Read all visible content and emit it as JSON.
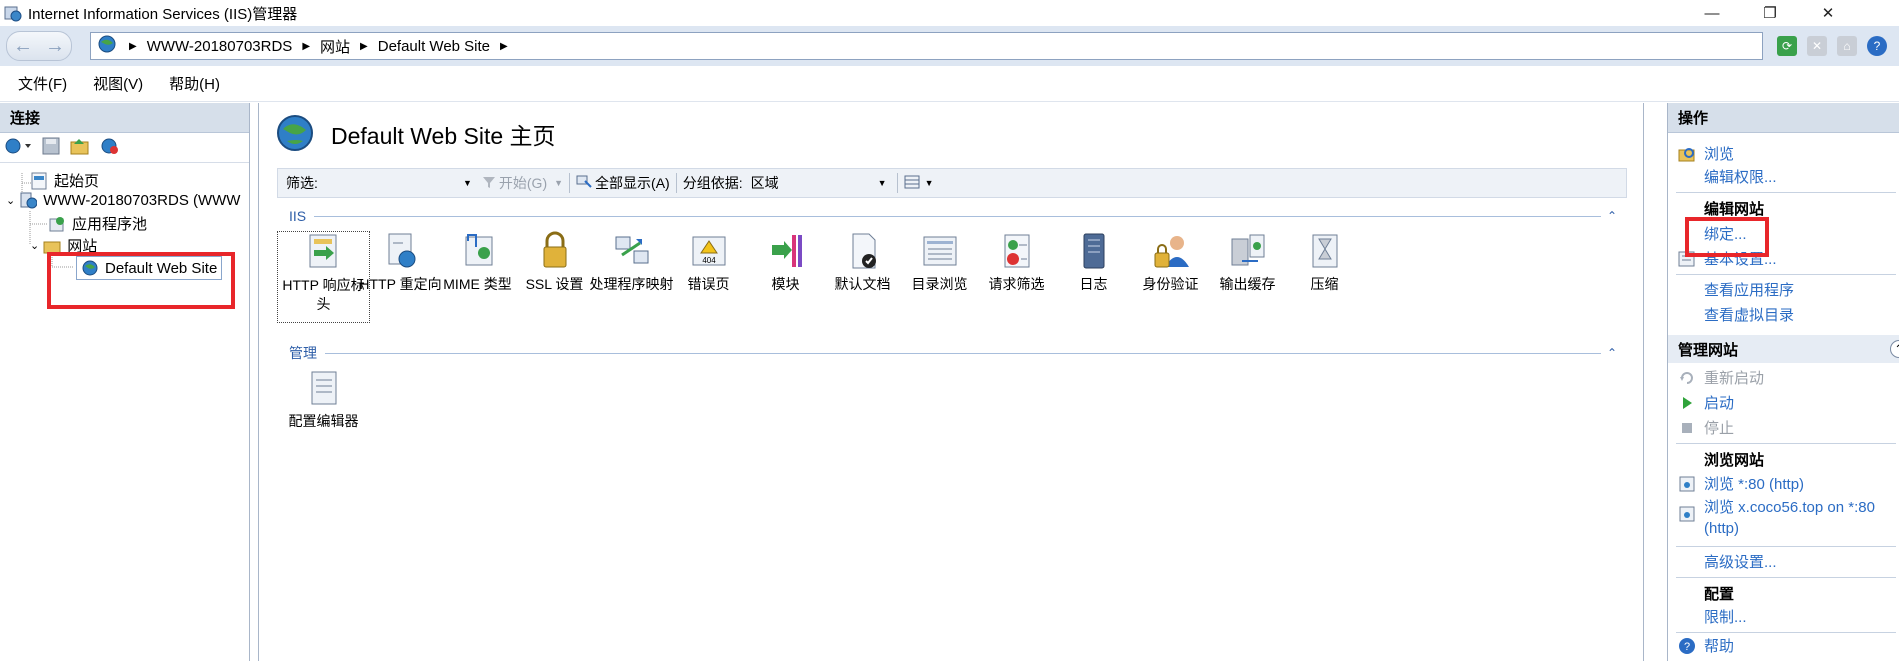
{
  "window": {
    "title": "Internet Information Services (IIS)管理器",
    "minimize": "—",
    "restore": "❐",
    "close": "✕"
  },
  "address": {
    "crumbs": [
      "WWW-20180703RDS",
      "网站",
      "Default Web Site"
    ]
  },
  "menu": [
    "文件(F)",
    "视图(V)",
    "帮助(H)"
  ],
  "left": {
    "header": "连接",
    "tree": {
      "start_page": "起始页",
      "server": "WWW-20180703RDS (WWW",
      "app_pools": "应用程序池",
      "sites": "网站",
      "default_site": "Default Web Site"
    }
  },
  "center": {
    "title": "Default Web Site 主页",
    "filter": {
      "label": "筛选:",
      "start": "开始(G)",
      "show_all": "全部显示(A)",
      "group_by_label": "分组依据:",
      "group_by_value": "区域"
    },
    "groups": {
      "iis": "IIS",
      "manage": "管理"
    },
    "iis_features": [
      "HTTP 响应标头",
      "HTTP 重定向",
      "MIME 类型",
      "SSL 设置",
      "处理程序映射",
      "错误页",
      "模块",
      "默认文档",
      "目录浏览",
      "请求筛选",
      "日志",
      "身份验证",
      "输出缓存",
      "压缩"
    ],
    "manage_features": [
      "配置编辑器"
    ]
  },
  "right": {
    "header": "操作",
    "browse": "浏览",
    "edit_permissions": "编辑权限...",
    "edit_site_title": "编辑网站",
    "bindings": "绑定...",
    "basic_settings": "基本设置...",
    "view_apps": "查看应用程序",
    "view_vdirs": "查看虚拟目录",
    "manage_site_title": "管理网站",
    "restart": "重新启动",
    "start": "启动",
    "stop": "停止",
    "browse_site_title": "浏览网站",
    "browse_80": "浏览 *:80 (http)",
    "browse_host_line1": "浏览 x.coco56.top on *:80",
    "browse_host_line2": "(http)",
    "advanced_settings": "高级设置...",
    "config_title": "配置",
    "limits": "限制...",
    "help": "帮助"
  },
  "colors": {
    "highlight": "#e8262a",
    "link": "#2b6cc4",
    "pane_header": "#d6dfea"
  }
}
